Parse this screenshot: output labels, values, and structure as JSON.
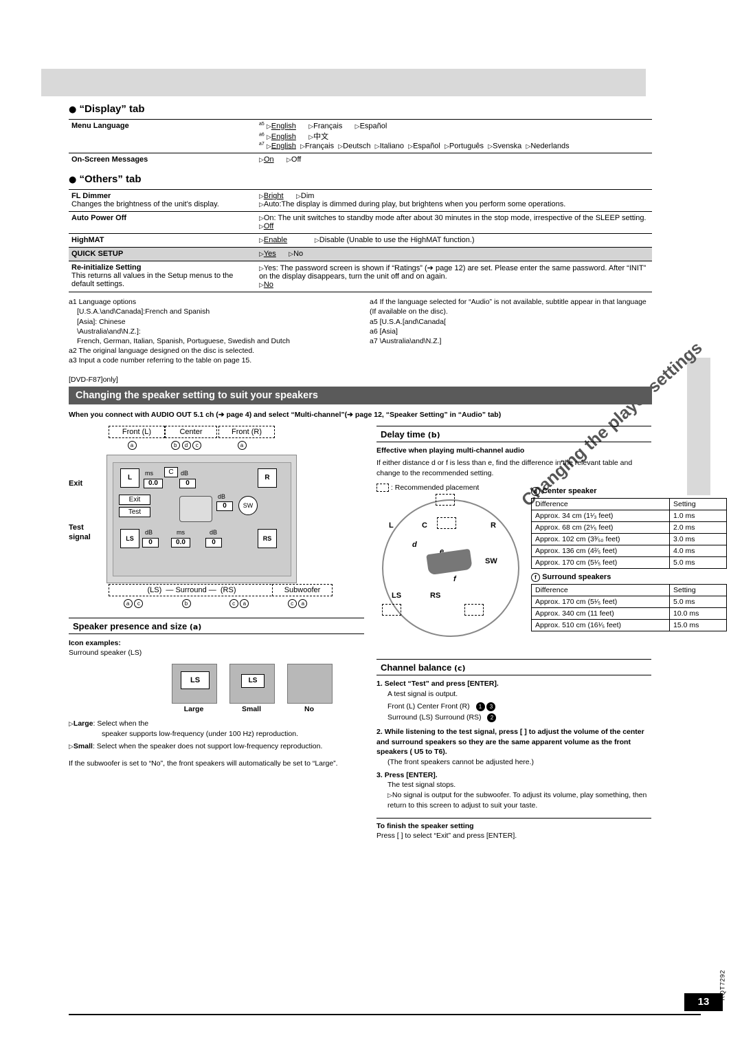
{
  "display_tab": {
    "heading": "“Display” tab",
    "rows": [
      {
        "label": "Menu Language",
        "lines": [
          {
            "note": "a5",
            "items": [
              "English",
              "Français",
              "Español"
            ]
          },
          {
            "note": "a6",
            "items": [
              "English",
              "中文"
            ]
          },
          {
            "note": "a7",
            "items": [
              "English",
              "Français",
              "Deutsch",
              "Italiano",
              "Español",
              "Português",
              "Svenska",
              "Nederlands"
            ]
          }
        ]
      },
      {
        "label": "On-Screen Messages",
        "options": [
          "On",
          "Off"
        ]
      }
    ]
  },
  "others_tab": {
    "heading": "“Others” tab",
    "rows": [
      {
        "label": "FL Dimmer",
        "sublabel": "Changes the brightness of the unit’s display.",
        "options": [
          "Bright",
          "Dim"
        ],
        "extra": "Auto:The display is dimmed during play, but brightens when you perform some operations."
      },
      {
        "label": "Auto Power Off",
        "options_long": "On:   The unit switches to standby mode after about 30 minutes in the stop mode, irrespective of the SLEEP setting.",
        "options2": "Off"
      },
      {
        "label": "HighMAT",
        "options": [
          "Enable"
        ],
        "extra": "Disable (Unable to use the HighMAT function.)"
      },
      {
        "label": "QUICK SETUP",
        "options": [
          "Yes",
          "No"
        ],
        "gray": true
      },
      {
        "label": "Re-initialize Setting",
        "sublabel": "This returns all values in the Setup menus to the default settings.",
        "yes_text": "Yes: The password screen is shown if “Ratings” (➔ page 12) are set. Please enter the same password. After “INIT” on the display disappears, turn the unit off and on again.",
        "no_text": "No"
      }
    ]
  },
  "footnotes_left": [
    "a1  Language options",
    "[U.S.A.\\and\\Canada]:French and Spanish",
    "[Asia]: Chinese",
    "\\Australia\\and\\N.Z.]:",
    "French, German, Italian, Spanish, Portuguese, Swedish and Dutch",
    "a2  The original language designed on the disc is selected.",
    "a3  Input a code number referring to the table on page 15."
  ],
  "footnotes_right": [
    "a4  If the language selected for “Audio” is not available, subtitle appear in that language (If available on the disc).",
    "a5  [U.S.A.[and\\Canada[",
    "a6  [Asia]",
    "a7  \\Australia\\and\\N.Z.]"
  ],
  "only_tag": "[DVD-F87]only]",
  "band_heading": "Changing the speaker setting to suit your speakers",
  "intro": "When you connect with AUDIO OUT 5.1 ch (➔ page 4) and select “Multi-channel”(➔ page 12, “Speaker Setting” in “Audio” tab)",
  "side_title": "Changing the player settings",
  "diagram": {
    "front_l": "Front (L)",
    "center": "Center",
    "front_r": "Front (R)",
    "exit_label": "Exit",
    "test_label": "Test",
    "signal_label": "signal",
    "exit_btn": "Exit",
    "test_btn": "Test",
    "l": "L",
    "r": "R",
    "ms": "ms",
    "db": "dB",
    "c": "C",
    "sw": "SW",
    "ls": "LS",
    "rs": "RS",
    "val_00": "0.0",
    "val_0": "0",
    "surround_label": "Surround",
    "ls_tag": "(LS)",
    "rs_tag": "(RS)",
    "subwoofer": "Subwoofer",
    "markers_front_l": [
      "a"
    ],
    "markers_center": [
      "b",
      "d",
      "c"
    ],
    "markers_front_r": [
      "a"
    ],
    "markers_ls": [
      "a",
      "c"
    ],
    "markers_mid": [
      "b"
    ],
    "markers_rs": [
      "c",
      "a"
    ],
    "markers_sub": [
      "c",
      "a"
    ]
  },
  "presence": {
    "heading": "Speaker presence and size",
    "heading_circ": "a",
    "icon_examples_label": "Icon examples:",
    "icon_examples_sub": "Surround speaker (LS)",
    "icons": [
      {
        "text": "LS",
        "caption": "Large"
      },
      {
        "text": "LS",
        "caption": "Small"
      },
      {
        "text": "",
        "caption": "No"
      }
    ],
    "large_text": "Large: Select when the speaker supports low-frequency (under 100 Hz) reproduction.",
    "large_bold": "Large",
    "large_rest": ": Select when the",
    "large_cont": "speaker supports low-frequency (under 100 Hz) reproduction.",
    "small_bold": "Small",
    "small_rest": ": Select when the speaker does not support low-frequency reproduction.",
    "note": "If the subwoofer is set to “No”, the front speakers will automatically be set to “Large”."
  },
  "delay": {
    "heading": "Delay time",
    "heading_circ": "b",
    "subhead": "Effective when playing multi-channel audio",
    "body": "If either distance d or f is less than e, find the difference in the relevant table and change to the recommended setting.",
    "recommended": ": Recommended placement",
    "center_title": "Center speaker",
    "center_circ": "d",
    "center_table": {
      "headers": [
        "Difference",
        "Setting"
      ],
      "rows": [
        [
          "Approx. 34 cm (1¹⁄₃ feet)",
          "1.0 ms"
        ],
        [
          "Approx. 68 cm (2¹⁄₅ feet)",
          "2.0 ms"
        ],
        [
          "Approx. 102 cm (3³⁄₅₀ feet)",
          "3.0 ms"
        ],
        [
          "Approx. 136 cm (4²⁄₅ feet)",
          "4.0 ms"
        ],
        [
          "Approx. 170 cm (5¹⁄₅ feet)",
          "5.0 ms"
        ]
      ]
    },
    "surround_title": "Surround speakers",
    "surround_circ": "f",
    "surround_table": {
      "headers": [
        "Difference",
        "Setting"
      ],
      "rows": [
        [
          "Approx. 170 cm (5¹⁄₅ feet)",
          "5.0 ms"
        ],
        [
          "Approx. 340 cm (11 feet)",
          "10.0 ms"
        ],
        [
          "Approx. 510 cm (16¹⁄₅ feet)",
          "15.0 ms"
        ]
      ]
    },
    "circle_labels": {
      "l": "L",
      "c": "C",
      "r": "R",
      "sw": "SW",
      "ls": "LS",
      "rs": "RS",
      "d": "d",
      "e": "e",
      "f": "f"
    }
  },
  "balance": {
    "heading": "Channel balance",
    "heading_circ": "c",
    "step1_bold": "Select “Test” and press [ENTER].",
    "step1_text": "A test signal is output.",
    "row1": "Front (L)     Center     Front (R)",
    "row2": "Surround (LS)              Surround (RS)",
    "marker1": "1",
    "marker2": "2",
    "marker3": "3",
    "step2_bold": "While listening to the test signal, press [    ] to adjust the volume of the center and surround speakers so they are the same apparent volume as the front speakers ( U5 to  T6).",
    "step2_text": "(The front speakers cannot be adjusted here.)",
    "step3_bold": "Press [ENTER].",
    "step3_text": "The test signal stops.",
    "step3_note": "No signal is output for the subwoofer. To adjust its volume, play something, then return to this screen to adjust to suit your taste.",
    "finish_head": "To finish the speaker setting",
    "finish_text": "Press [         ] to select “Exit” and press [ENTER]."
  },
  "page_number": "13",
  "rqt": "RQT7292"
}
